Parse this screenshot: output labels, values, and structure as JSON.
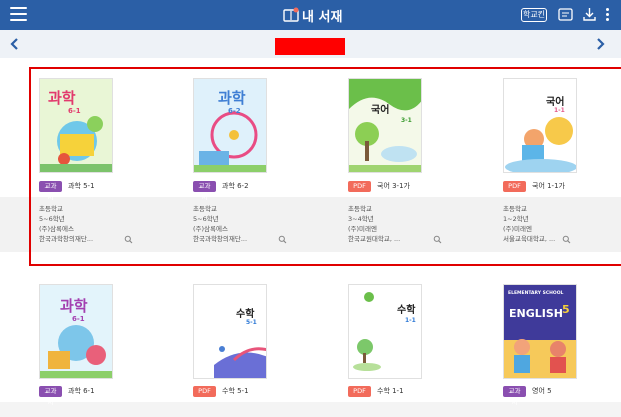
{
  "header": {
    "title": "내 서재",
    "school_button": "학교킨",
    "colors": {
      "bar": "#2b5fa6",
      "highlight": "#e00000"
    }
  },
  "icons": {
    "menu": "hamburger-menu-icon",
    "back": "chevron-left-icon",
    "forward": "chevron-right-icon",
    "book": "book-icon",
    "download": "download-icon",
    "more": "more-vertical-icon",
    "search": "search-icon"
  },
  "books_row1": [
    {
      "cover_title": "과학",
      "cover_sub": "6-1",
      "badge": "교과서",
      "badge_type": "tb",
      "name": "과학 5-1",
      "school": "초등학교",
      "grade": "5~6학년",
      "publisher": "(주)삼록에스",
      "author": "한국과학창의재단..."
    },
    {
      "cover_title": "과학",
      "cover_sub": "6-2",
      "badge": "교과서",
      "badge_type": "tb",
      "name": "과학 6-2",
      "school": "초등학교",
      "grade": "5~6학년",
      "publisher": "(주)삼록에스",
      "author": "한국과학창의재단..."
    },
    {
      "cover_title": "국어",
      "cover_sub": "3-1",
      "badge": "PDF",
      "badge_type": "pdf",
      "name": "국어 3-1가",
      "school": "초등학교",
      "grade": "3~4학년",
      "publisher": "(주)미래엔",
      "author": "한국교원대학교, ..."
    },
    {
      "cover_title": "국어",
      "cover_sub": "1-1",
      "badge": "PDF",
      "badge_type": "pdf",
      "name": "국어 1-1가",
      "school": "초등학교",
      "grade": "1~2학년",
      "publisher": "(주)미래엔",
      "author": "서울교육대학교, ..."
    }
  ],
  "books_row2": [
    {
      "cover_title": "과학",
      "cover_sub": "6-1",
      "badge": "교과서",
      "badge_type": "tb",
      "name": "과학 6-1"
    },
    {
      "cover_title": "수학",
      "cover_sub": "5-1",
      "badge": "PDF",
      "badge_type": "pdf",
      "name": "수학 5-1"
    },
    {
      "cover_title": "수학",
      "cover_sub": "1-1",
      "badge": "PDF",
      "badge_type": "pdf",
      "name": "수학 1-1"
    },
    {
      "cover_title": "ENGLISH",
      "cover_sub": "5",
      "cover_top": "ELEMENTARY SCHOOL",
      "badge": "교과서",
      "badge_type": "tb",
      "name": "영어 5"
    }
  ]
}
